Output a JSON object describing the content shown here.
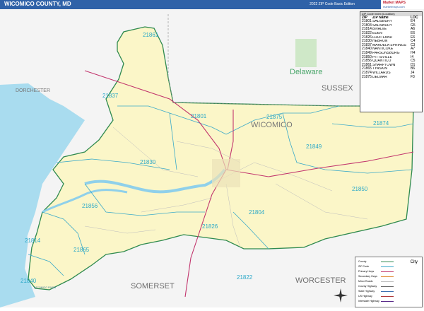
{
  "header": {
    "title": "WICOMICO COUNTY, MD",
    "subtitle": "2022 ZIP Code Basic Edition",
    "brand_line1": "Market MAPS",
    "brand_line2": "marketmaps.com"
  },
  "colors": {
    "county_fill": "#fbf6c8",
    "outside_fill": "#f4f4f4",
    "water": "#a9dcef",
    "zip_boundary": "#3aa9c9",
    "county_boundary": "#2f8a4f",
    "highway": "#c2366e",
    "title_bar": "#2f62a8"
  },
  "map": {
    "region_labels": [
      "DORCHESTER",
      "SUSSEX",
      "WICOMICO",
      "SOMERSET",
      "WORCESTER"
    ],
    "state_label": "Delaware",
    "river_label": "WICOMICO RIVER",
    "zip_labels": [
      "21861",
      "21837",
      "21801",
      "21875",
      "21874",
      "21849",
      "21830",
      "21850",
      "21856",
      "21804",
      "21814",
      "21865",
      "21826",
      "21840",
      "21822"
    ]
  },
  "zip_table": {
    "header": "ZIP Code Index (Location)",
    "columns": [
      "ZIP",
      "ZIP Name",
      "LOC"
    ],
    "rows": [
      [
        "21801",
        "SALISBURY",
        "E4"
      ],
      [
        "21804",
        "SALISBURY",
        "G5"
      ],
      [
        "21814",
        "BIVALVE",
        "A6"
      ],
      [
        "21822",
        "EDEN",
        "E6"
      ],
      [
        "21826",
        "FRUITLAND",
        "E6"
      ],
      [
        "21830",
        "HEBRON",
        "C4"
      ],
      [
        "21837",
        "MARDELA SPRINGS",
        "C3"
      ],
      [
        "21840",
        "NANTICOKE",
        "A7"
      ],
      [
        "21849",
        "PARSONSBURG",
        "H4"
      ],
      [
        "21850",
        "PITTSVILLE",
        "I4"
      ],
      [
        "21856",
        "QUANTICO",
        "C5"
      ],
      [
        "21861",
        "SHARPTOWN",
        "D1"
      ],
      [
        "21865",
        "TYASKIN",
        "B6"
      ],
      [
        "21874",
        "WILLARDS",
        "J4"
      ],
      [
        "21875",
        "DELMAR",
        "F3"
      ]
    ]
  },
  "legend": {
    "items": [
      "County",
      "ZIP Code",
      "Primary Hwys",
      "Secondary Hwys",
      "Minor Roads",
      "County Highway",
      "State Highway",
      "US Highway",
      "Interstate Highway"
    ],
    "scale_label": "City"
  }
}
